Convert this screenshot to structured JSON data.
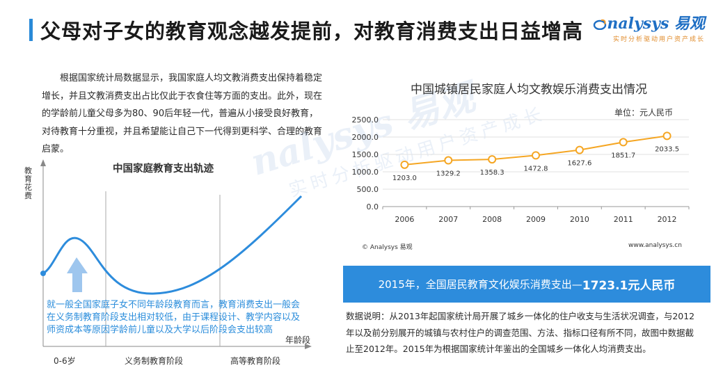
{
  "header": {
    "title": "父母对子女的教育观念越发提前，对教育消费支出日益增高",
    "logo_name": "nalysys 易观",
    "logo_tagline": "实时分析驱动用户资产成长"
  },
  "intro": "根据国家统计局数据显示，我国家庭人均文教消费支出保持着稳定增长，并且文教消费支出占比仅此于衣食住等方面的支出。此外，现在的学龄前儿童父母多为80、90后年轻一代，普遍从小接受良好教育，对待教育十分重视，并且希望能让自己下一代得到更科学、合理的教育启蒙。",
  "trajectory": {
    "title": "中国家庭教育支出轨迹",
    "y_label": "教育花费",
    "x_label": "年龄段",
    "note": "就一般全国家庭子女不同年龄段教育而言，教育消费支出一般会在义务制教育阶段支出相对较低，由于课程设计、教学内容以及师资成本等原因学龄前儿童以及大学以后阶段会支出较高",
    "stages": [
      "0-6岁",
      "义务制教育阶段",
      "高等教育阶段"
    ]
  },
  "watermark": {
    "main": "nalysys 易观",
    "sub": "实时分析驱动用户资产成长"
  },
  "chart_data": {
    "type": "line",
    "title": "中国城镇居民家庭人均文教娱乐消费支出情况",
    "unit": "单位：元人民币",
    "x": [
      "2006",
      "2007",
      "2008",
      "2009",
      "2010",
      "2011",
      "2012"
    ],
    "values": [
      1203.0,
      1329.2,
      1358.3,
      1472.8,
      1627.6,
      1851.7,
      2033.5
    ],
    "value_labels": [
      "1203.0",
      "1329.2",
      "1358.3",
      "1472.8",
      "1627.6",
      "1851.7",
      "2033.5"
    ],
    "ylim": [
      0,
      2500
    ],
    "y_ticks": [
      "0.0",
      "500.0",
      "1000.0",
      "1500.0",
      "2000.0",
      "2500.0"
    ],
    "grid": true,
    "line_color": "#f5a623",
    "source": "© Analysys 易观",
    "website": "www.analysys.cn"
  },
  "banner": {
    "prefix": "2015年，全国居民教育文化娱乐消费支出—",
    "highlight": "1723.1元人民币"
  },
  "description": "数据说明：从2013年起国家统计局开展了城乡一体化的住户收支与生活状况调查，与2012年以及前分别展开的城镇与农村住户的调查范围、方法、指标口径有所不同，故图中数据截止至2012年。2015年为根据国家统计年鉴出的全国城乡一体化人均消费支出。"
}
